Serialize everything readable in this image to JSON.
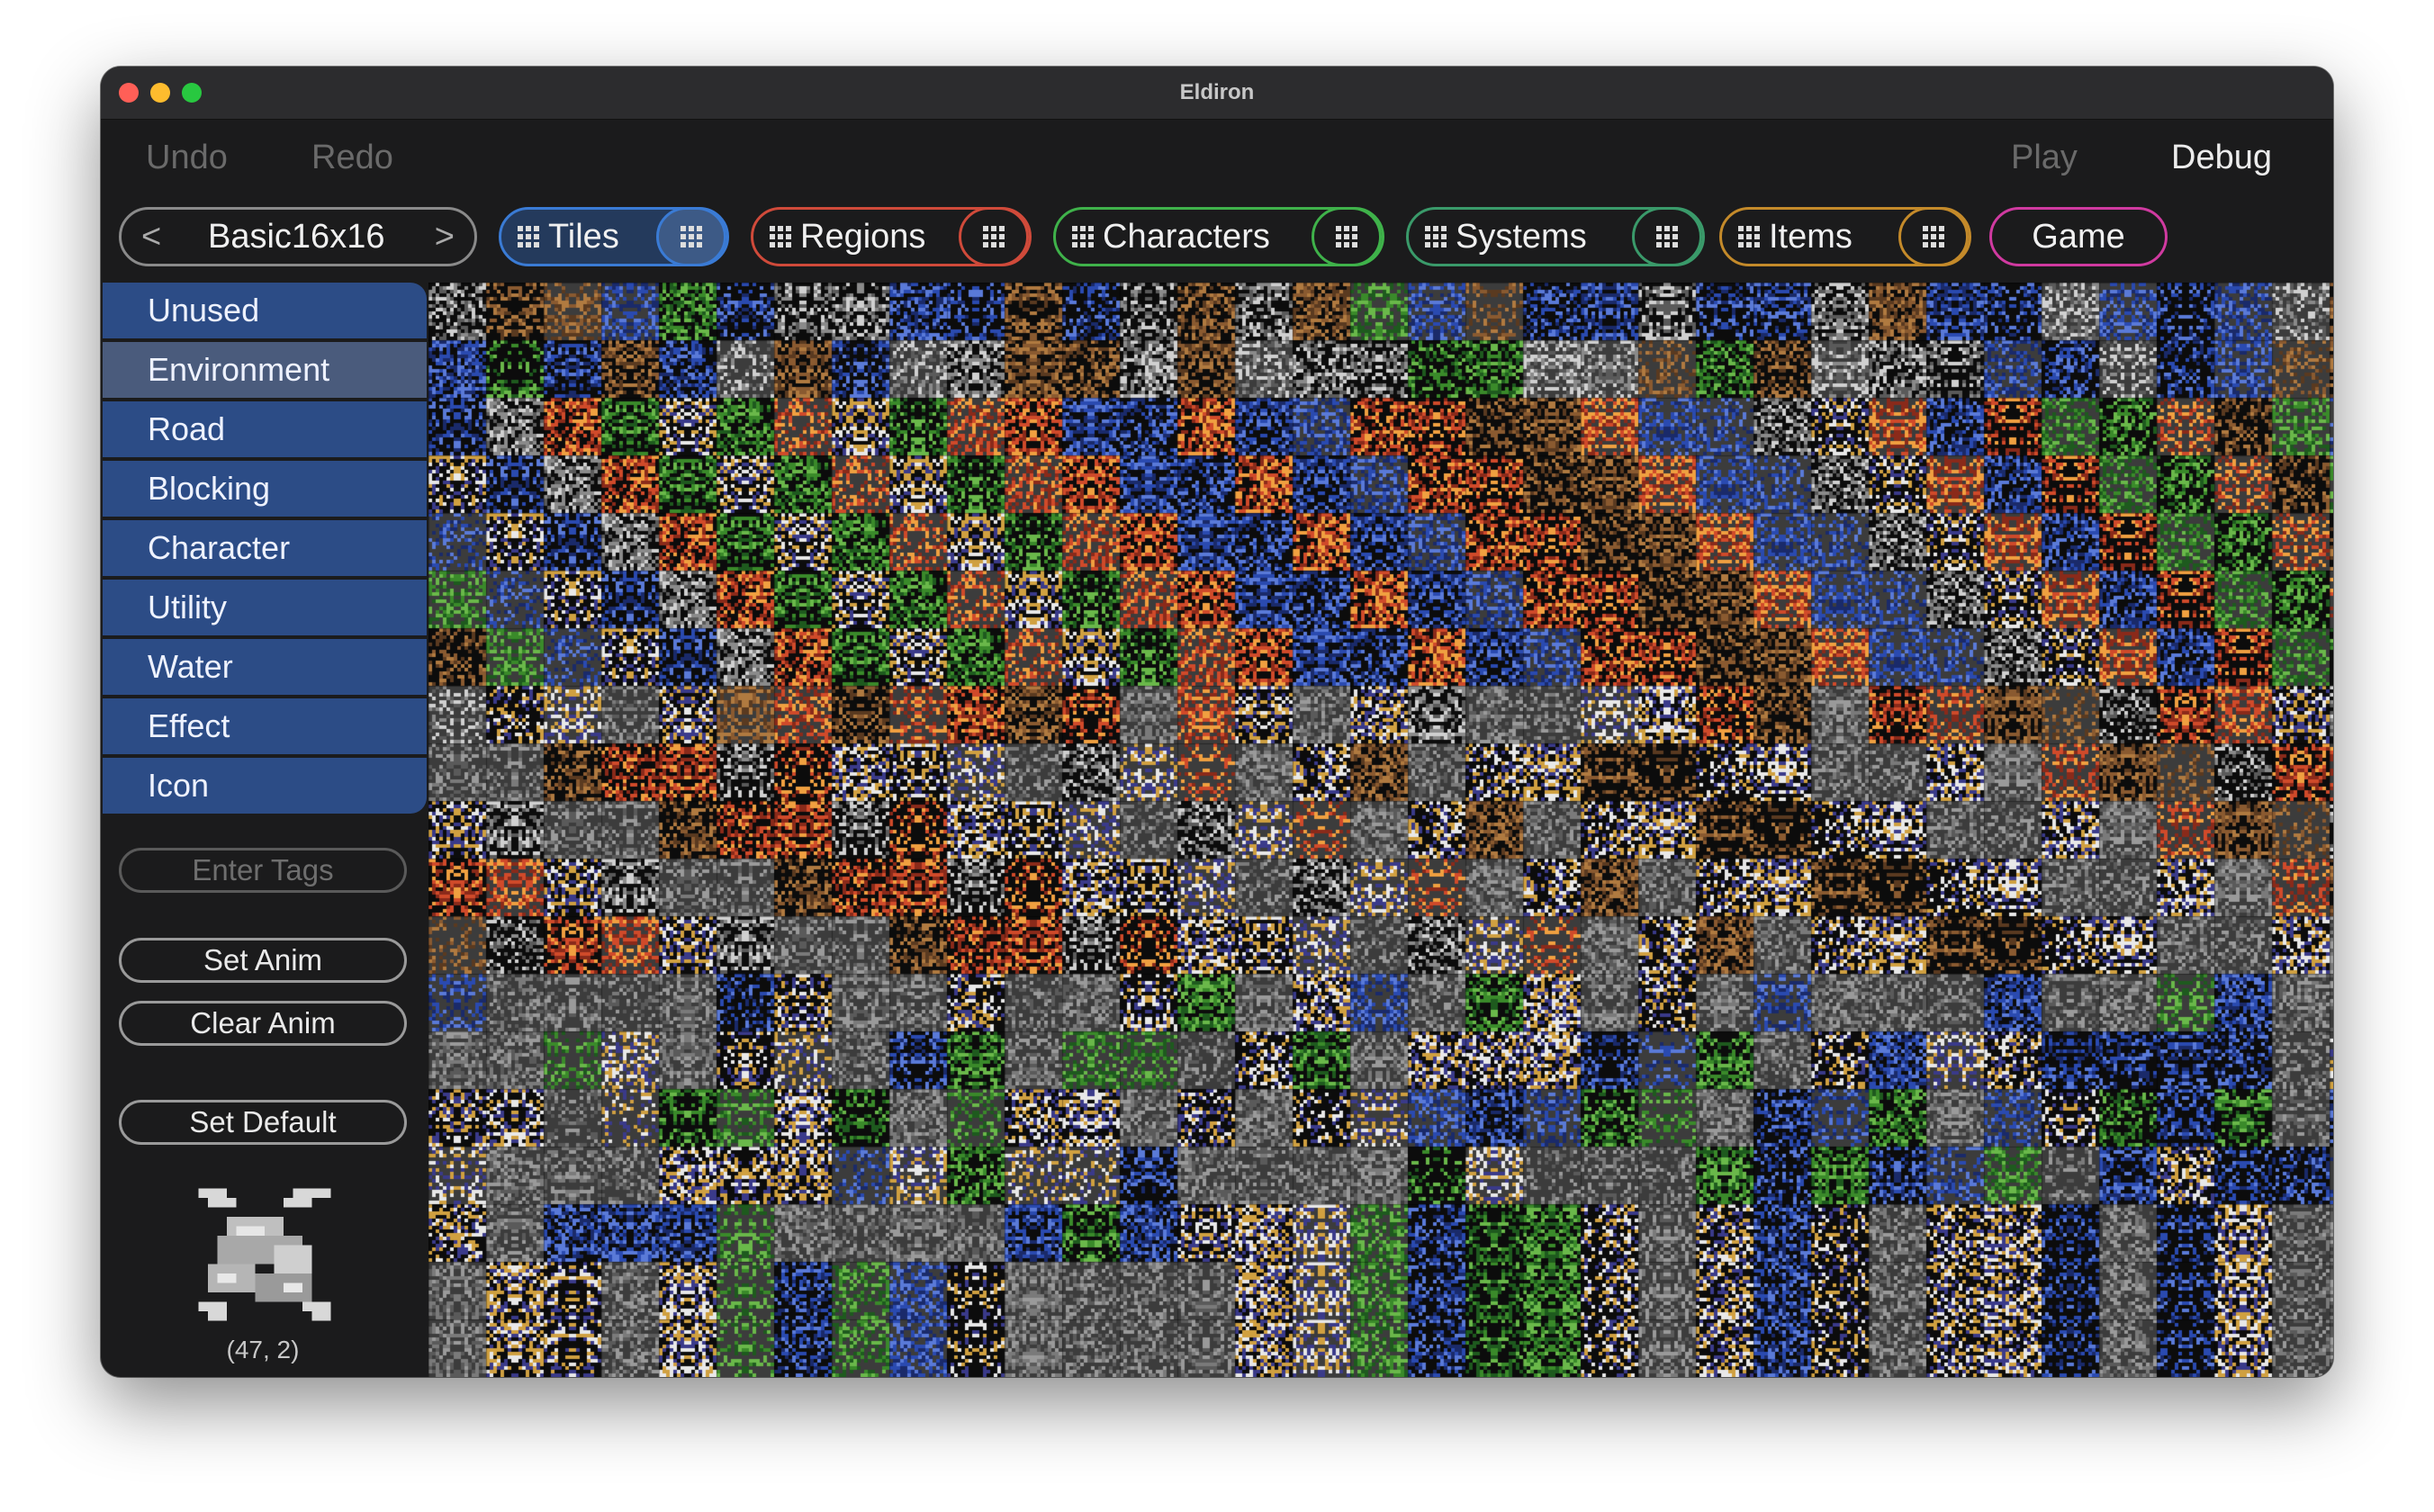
{
  "window": {
    "title": "Eldiron"
  },
  "toolbar": {
    "undo": "Undo",
    "redo": "Redo",
    "play": "Play",
    "debug": "Debug"
  },
  "tilemap_selector": {
    "prev": "<",
    "name": "Basic16x16",
    "next": ">"
  },
  "tabs": [
    {
      "label": "Tiles",
      "color": "#3a7bd5",
      "active": true
    },
    {
      "label": "Regions",
      "color": "#d04a3a"
    },
    {
      "label": "Characters",
      "color": "#3fb24a"
    },
    {
      "label": "Systems",
      "color": "#3a9a6a"
    },
    {
      "label": "Items",
      "color": "#c48a2a"
    },
    {
      "label": "Game",
      "color": "#d03aa0"
    }
  ],
  "categories": [
    {
      "label": "Unused"
    },
    {
      "label": "Environment",
      "selected": true
    },
    {
      "label": "Road"
    },
    {
      "label": "Blocking"
    },
    {
      "label": "Character"
    },
    {
      "label": "Utility"
    },
    {
      "label": "Water"
    },
    {
      "label": "Effect"
    },
    {
      "label": "Icon"
    }
  ],
  "tags": {
    "placeholder": "Enter Tags"
  },
  "buttons": {
    "set_anim": "Set Anim",
    "clear_anim": "Clear Anim",
    "set_default": "Set Default"
  },
  "preview": {
    "coordinates": "(47, 2)"
  },
  "tileset": {
    "selected_tile": [
      47,
      2
    ]
  },
  "traffic_lights": {
    "close": "#ff5f57",
    "minimize": "#febc2e",
    "zoom": "#28c840"
  }
}
